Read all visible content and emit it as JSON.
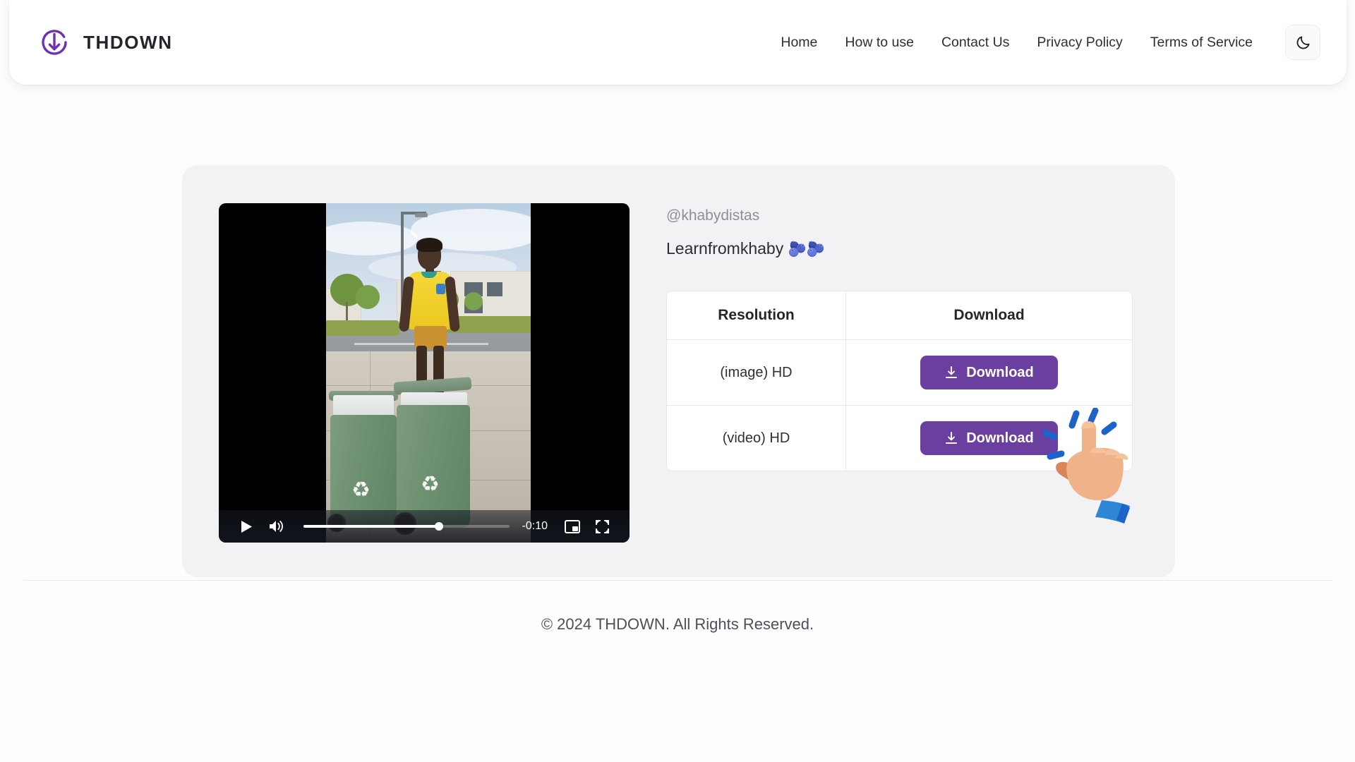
{
  "header": {
    "brand_name": "THDOWN",
    "logo_icon": "circular-download-arrow-logo",
    "nav": [
      {
        "label": "Home",
        "name": "home"
      },
      {
        "label": "How to use",
        "name": "how-to-use"
      },
      {
        "label": "Contact Us",
        "name": "contact-us"
      },
      {
        "label": "Privacy Policy",
        "name": "privacy-policy"
      },
      {
        "label": "Terms of Service",
        "name": "terms-of-service"
      }
    ],
    "theme_toggle_icon": "moon-icon"
  },
  "result": {
    "author_handle": "@khabydistas",
    "video_title": "Learnfromkhaby",
    "title_emoji": "🫐🫐",
    "video": {
      "alt": "man-in-yellow-jersey-pushing-two-green-recycling-bins",
      "time_remaining": "-0:10",
      "progress_percent": 66,
      "play_icon": "play-icon",
      "volume_icon": "volume-high-icon",
      "pip_icon": "picture-in-picture-icon",
      "fullscreen_icon": "fullscreen-icon"
    },
    "table": {
      "headers": [
        "Resolution",
        "Download"
      ],
      "rows": [
        {
          "resolution": "(image) HD",
          "button_label": "Download",
          "button_icon": "download-icon"
        },
        {
          "resolution": "(video) HD",
          "button_label": "Download",
          "button_icon": "download-icon"
        }
      ]
    },
    "cursor_icon": "pointing-hand-click-cursor"
  },
  "footer": {
    "copyright": "© 2024 THDOWN. All Rights Reserved."
  },
  "colors": {
    "accent_purple": "#6b3fa0",
    "card_background": "#f2f2f5",
    "page_background": "#fdfdfd",
    "muted_text": "#8d9096"
  }
}
